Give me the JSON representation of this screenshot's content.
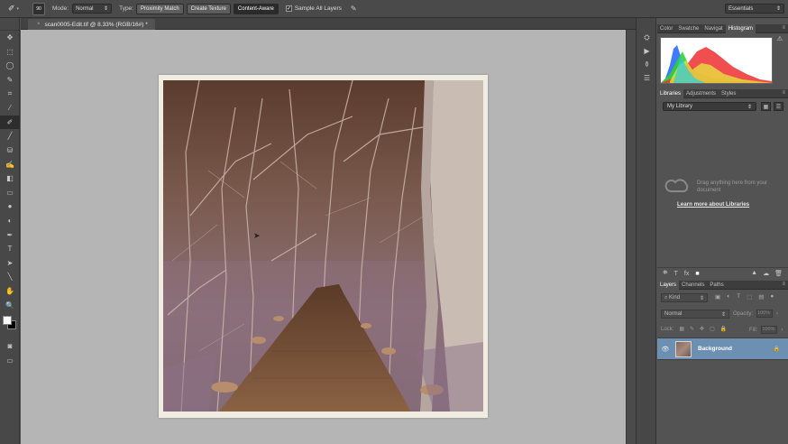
{
  "options_bar": {
    "brush_size": "90",
    "mode_label": "Mode:",
    "mode_value": "Normal",
    "type_label": "Type:",
    "type_buttons": [
      "Proximity Match",
      "Create Texture",
      "Content-Aware"
    ],
    "sample_all_layers_label": "Sample All Layers",
    "workspace": "Essentials"
  },
  "document": {
    "tab_title": "scan0005-Edit.tif @ 8.33% (RGB/16#) *",
    "close_glyph": "×"
  },
  "tools": {
    "icons": [
      "move-icon",
      "marquee-icon",
      "lasso-icon",
      "quick-select-icon",
      "crop-icon",
      "eyedropper-icon",
      "spot-healing-brush-icon",
      "brush-icon",
      "clone-stamp-icon",
      "history-brush-icon",
      "eraser-icon",
      "gradient-icon",
      "blur-icon",
      "dodge-icon",
      "pen-icon",
      "type-icon",
      "path-select-icon",
      "line-icon",
      "hand-icon",
      "zoom-icon"
    ],
    "glyphs": [
      "✥",
      "⬚",
      "◯",
      "✎",
      "⌗",
      "⁄",
      "✐",
      "╱",
      "⛁",
      "✍",
      "◧",
      "▭",
      "●",
      "◐",
      "✒",
      "T",
      "➤",
      "╲",
      "✋",
      "🔍"
    ],
    "selected_index": 6,
    "foreground_color": "#ffffff",
    "background_color": "#000000"
  },
  "strip_icons": [
    "⛭",
    "▶",
    "⚱",
    "☰"
  ],
  "histogram_panel": {
    "tabs": [
      "Color",
      "Swatche",
      "Navigat",
      "Histogram"
    ],
    "active_tab": "Histogram",
    "warning_glyph": "⚠"
  },
  "libraries_panel": {
    "tabs": [
      "Libraries",
      "Adjustments",
      "Styles"
    ],
    "active_tab": "Libraries",
    "library_select": "My Library",
    "drag_text": "Drag anything here from your document",
    "learn_link": "Learn more about Libraries",
    "footer_left": [
      "⛯",
      "T",
      "fx",
      "■"
    ],
    "footer_right": [
      "▲",
      "☁",
      "🗑"
    ]
  },
  "layers_panel": {
    "tabs": [
      "Layers",
      "Channels",
      "Paths"
    ],
    "active_tab": "Layers",
    "kind_filter": "Kind",
    "filter_icons": [
      "▣",
      "◐",
      "T",
      "⬚",
      "▤",
      "●"
    ],
    "blend_mode": "Normal",
    "opacity_label": "Opacity:",
    "opacity_value": "100%",
    "lock_label": "Lock:",
    "lock_icons": [
      "▦",
      "✎",
      "✥",
      "▢",
      "🔒"
    ],
    "fill_label": "Fill:",
    "fill_value": "100%",
    "layer_name": "Background",
    "eye_glyph": "👁",
    "lock_glyph": "🔒"
  },
  "colors": {
    "canvas_bg": "#b5b5b5",
    "panel_bg": "#535353",
    "selected_layer": "#6d8fb1",
    "photo_tint": "#6a4a3a"
  }
}
